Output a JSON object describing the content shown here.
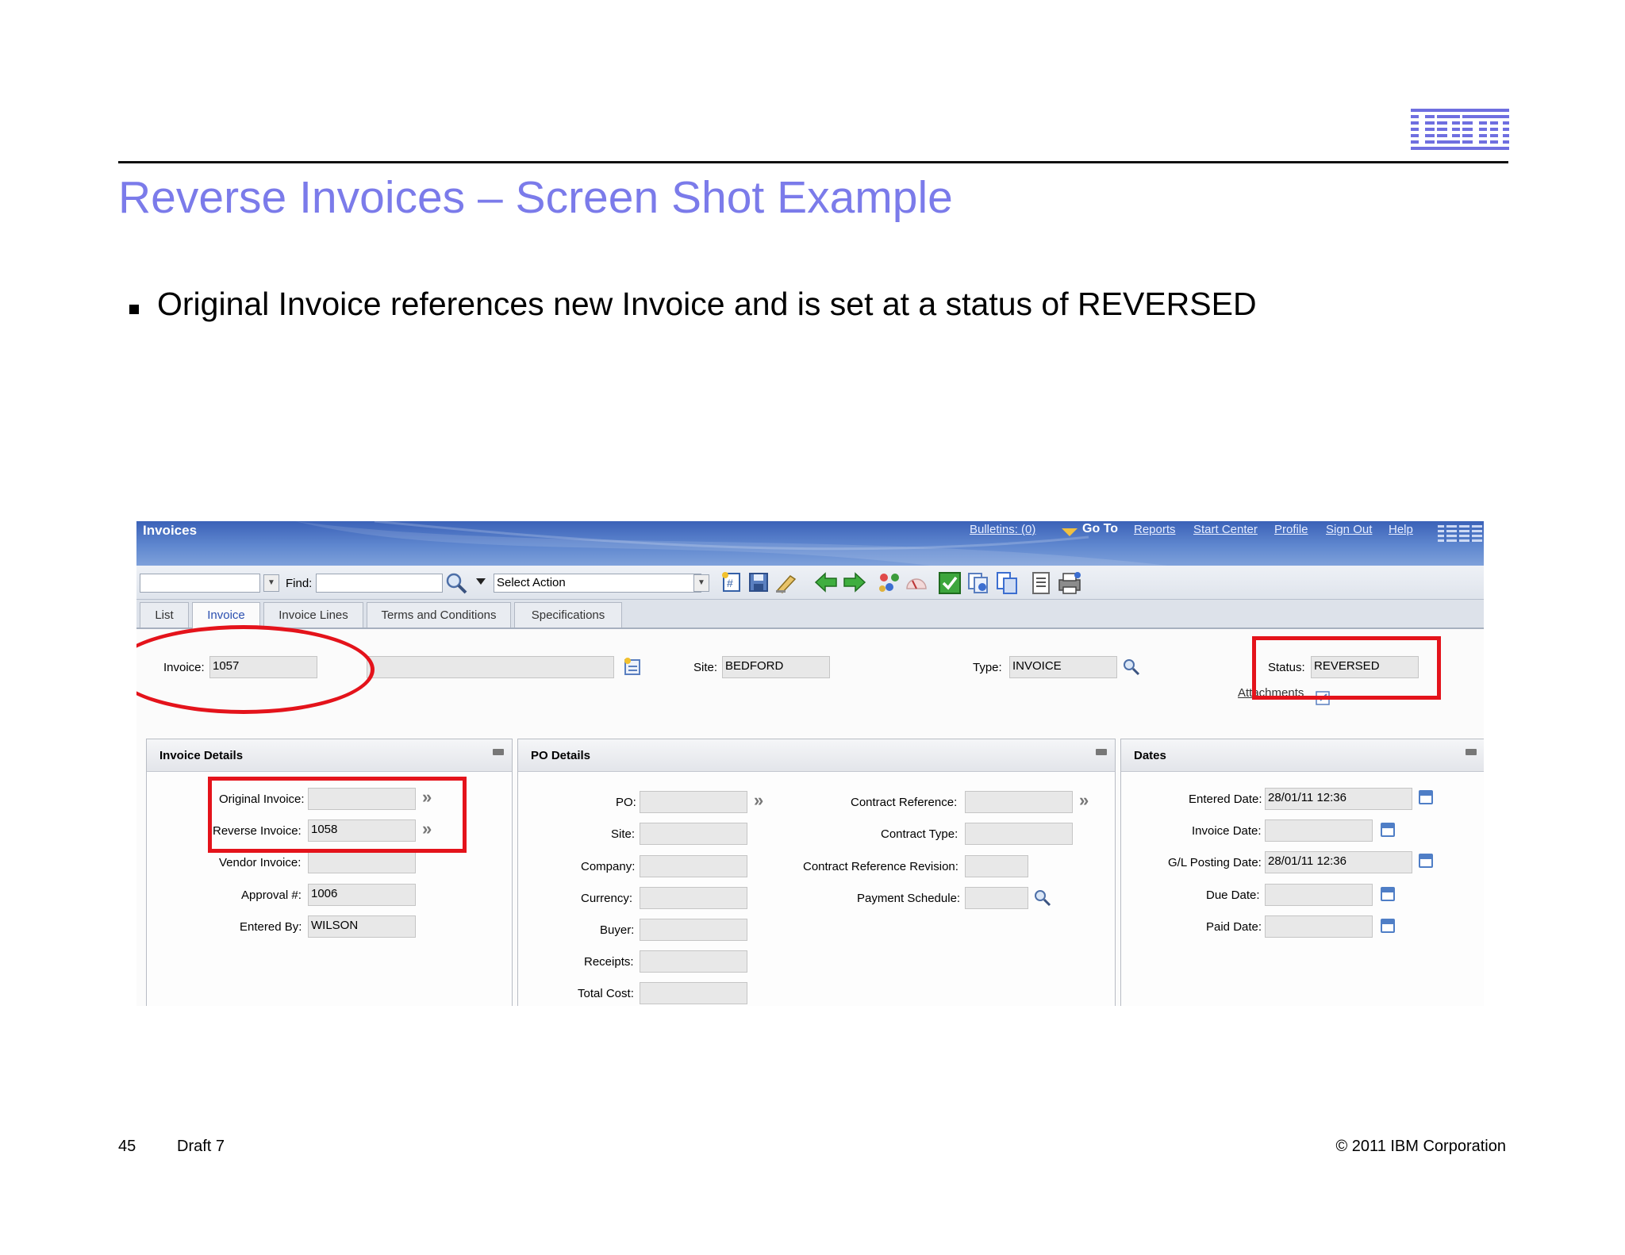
{
  "slide": {
    "title": "Reverse Invoices – Screen Shot Example",
    "bullet": "Original Invoice references new Invoice and is set at a status of REVERSED",
    "page_number": "45",
    "draft": "Draft 7",
    "copyright": "© 2011 IBM Corporation",
    "logo": "IBM"
  },
  "app": {
    "title": "Invoices",
    "nav": {
      "bulletins": "Bulletins: (0)",
      "goto": "Go To",
      "reports": "Reports",
      "start_center": "Start Center",
      "profile": "Profile",
      "sign_out": "Sign Out",
      "help": "Help"
    },
    "toolbar": {
      "find_label": "Find:",
      "select_action": "Select Action",
      "icons": [
        "new-record-icon",
        "save-icon",
        "clear-changes-icon",
        "previous-record-icon",
        "next-record-icon",
        "workflow-icon",
        "route-workflow-icon",
        "approve-icon",
        "duplicate-icon",
        "copy-icon",
        "report-icon",
        "print-icon"
      ]
    },
    "tabs": [
      "List",
      "Invoice",
      "Invoice Lines",
      "Terms and Conditions",
      "Specifications"
    ],
    "active_tab": "Invoice",
    "header": {
      "invoice_label": "Invoice:",
      "invoice_value": "1057",
      "description_value": "",
      "site_label": "Site:",
      "site_value": "BEDFORD",
      "type_label": "Type:",
      "type_value": "INVOICE",
      "status_label": "Status:",
      "status_value": "REVERSED",
      "attachments_label": "Attachments"
    },
    "invoice_details": {
      "title": "Invoice Details",
      "original_invoice_label": "Original Invoice:",
      "original_invoice_value": "",
      "reverse_invoice_label": "Reverse Invoice:",
      "reverse_invoice_value": "1058",
      "vendor_invoice_label": "Vendor Invoice:",
      "vendor_invoice_value": "",
      "approval_label": "Approval #:",
      "approval_value": "1006",
      "entered_by_label": "Entered By:",
      "entered_by_value": "WILSON"
    },
    "po_details": {
      "title": "PO Details",
      "po_label": "PO:",
      "site_label": "Site:",
      "company_label": "Company:",
      "currency_label": "Currency:",
      "buyer_label": "Buyer:",
      "receipts_label": "Receipts:",
      "total_cost_label": "Total Cost:",
      "contract_reference_label": "Contract Reference:",
      "contract_type_label": "Contract Type:",
      "contract_reference_revision_label": "Contract Reference Revision:",
      "payment_schedule_label": "Payment Schedule:"
    },
    "dates": {
      "title": "Dates",
      "entered_date_label": "Entered Date:",
      "entered_date_value": "28/01/11 12:36",
      "invoice_date_label": "Invoice Date:",
      "invoice_date_value": "",
      "gl_posting_date_label": "G/L Posting Date:",
      "gl_posting_date_value": "28/01/11 12:36",
      "due_date_label": "Due Date:",
      "due_date_value": "",
      "paid_date_label": "Paid Date:",
      "paid_date_value": ""
    },
    "colors": {
      "highlight": "#e4131b",
      "title_blue": "#7b7bea",
      "header_blue": "#3b62b8"
    }
  }
}
